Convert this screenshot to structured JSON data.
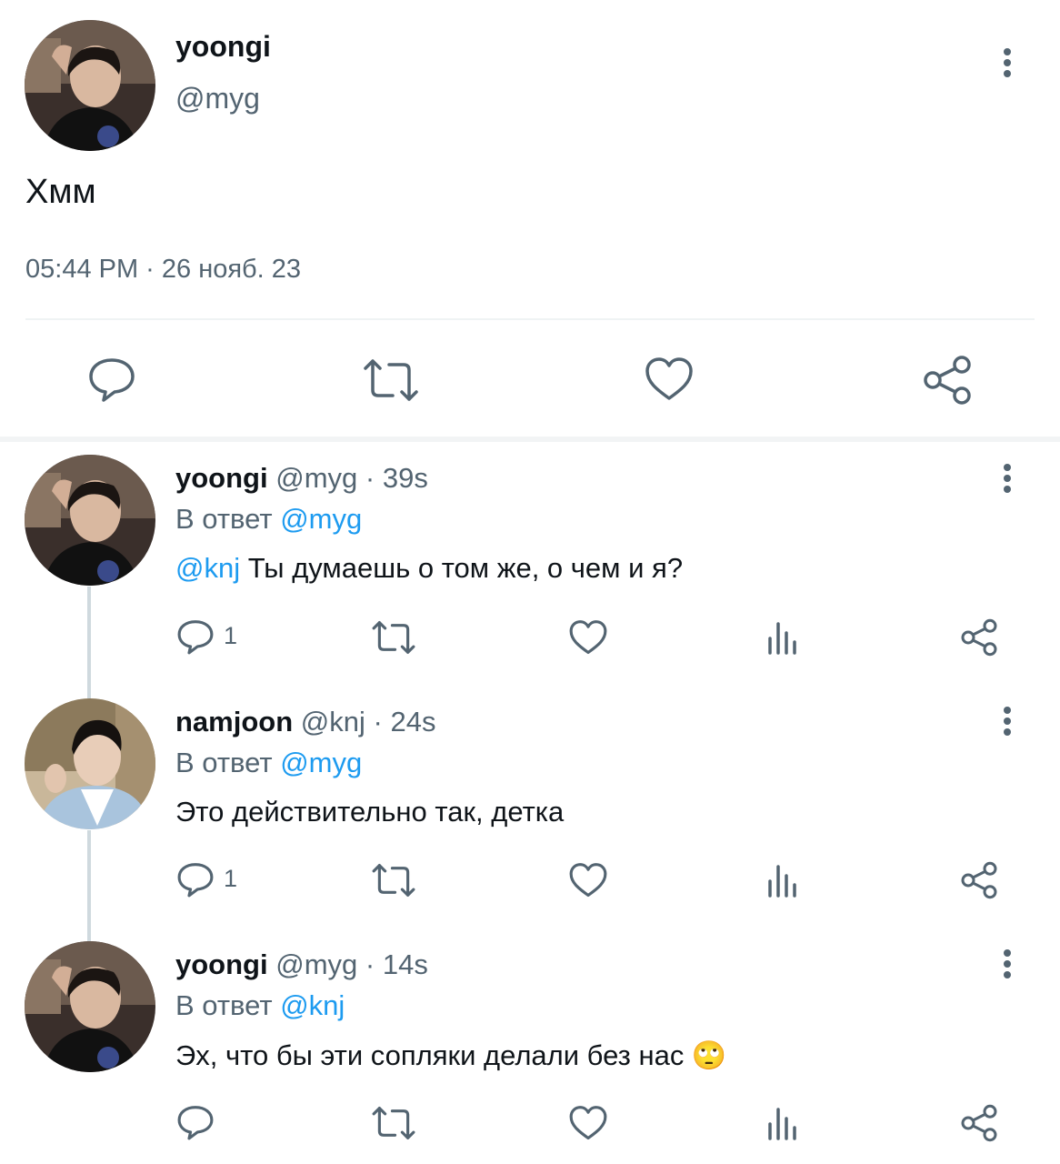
{
  "main_tweet": {
    "name": "yoongi",
    "handle": "@myg",
    "text": "Хмм",
    "timestamp": "05:44 PM · 26 нояб. 23"
  },
  "replies": [
    {
      "name": "yoongi",
      "handle": "@myg",
      "time": "· 39s",
      "reply_prefix": "В ответ",
      "reply_to": "@myg",
      "mention": "@knj",
      "text": " Ты думаешь о том же, о чем и я?",
      "reply_count": "1"
    },
    {
      "name": "namjoon",
      "handle": "@knj",
      "time": "· 24s",
      "reply_prefix": "В ответ",
      "reply_to": "@myg",
      "text": "Это действительно так, детка",
      "reply_count": "1"
    },
    {
      "name": "yoongi",
      "handle": "@myg",
      "time": "· 14s",
      "reply_prefix": "В ответ",
      "reply_to": "@knj",
      "text": "Эх, что бы эти сопляки делали без нас 🙄"
    }
  ],
  "icons": {
    "reply": "reply-icon",
    "retweet": "retweet-icon",
    "like": "heart-icon",
    "views": "views-icon",
    "share": "share-icon",
    "more": "more-vertical-icon"
  },
  "colors": {
    "accent": "#1d9bf0",
    "muted": "#536471",
    "text": "#0f1419"
  }
}
